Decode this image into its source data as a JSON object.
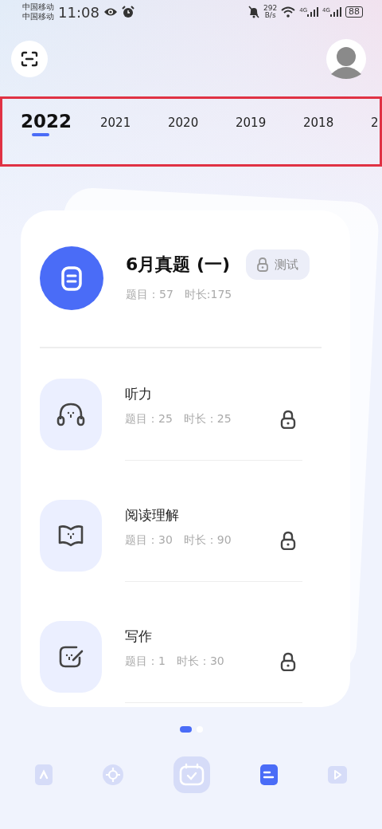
{
  "status_bar": {
    "carriers": [
      "中国移动",
      "中国移动"
    ],
    "time": "11:08",
    "speed_value": "292",
    "speed_unit": "B/s",
    "networks": [
      "4G",
      "4G"
    ],
    "battery": "88"
  },
  "years": [
    {
      "label": "2022",
      "selected": true
    },
    {
      "label": "2021",
      "selected": false
    },
    {
      "label": "2020",
      "selected": false
    },
    {
      "label": "2019",
      "selected": false
    },
    {
      "label": "2018",
      "selected": false
    },
    {
      "label": "2",
      "selected": false
    }
  ],
  "exam": {
    "title": "6月真题 (一)",
    "badge": "测试",
    "questions": "题目：57",
    "duration": "时长:175"
  },
  "sections": [
    {
      "kind": "headphones",
      "name": "听力",
      "questions": "题目：25",
      "duration": "时长：25"
    },
    {
      "kind": "book",
      "name": "阅读理解",
      "questions": "题目：30",
      "duration": "时长：90"
    },
    {
      "kind": "edit",
      "name": "写作",
      "questions": "题目：1",
      "duration": "时长：30"
    }
  ],
  "pager": [
    {
      "selected": true
    },
    {
      "selected": false
    }
  ],
  "nav": [
    {
      "kind": "letter",
      "selected": false
    },
    {
      "kind": "target",
      "selected": false
    },
    {
      "kind": "calendar",
      "selected": false
    },
    {
      "kind": "doc",
      "selected": true
    },
    {
      "kind": "play",
      "selected": false
    }
  ]
}
